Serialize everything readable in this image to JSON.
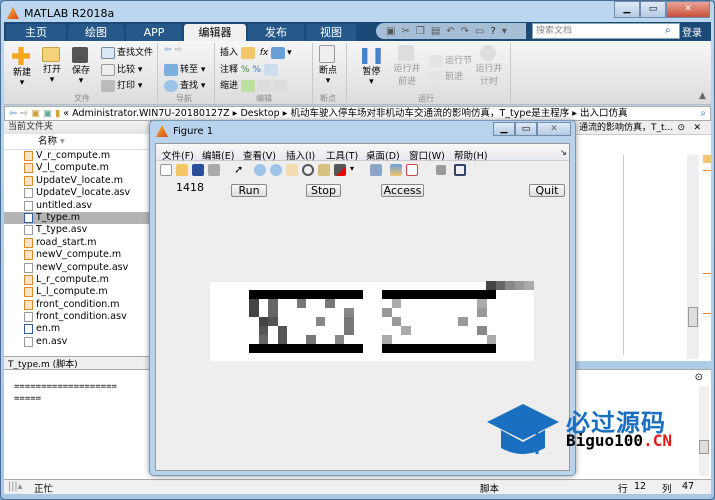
{
  "app": {
    "title": "MATLAB R2018a"
  },
  "tabs": [
    "主页",
    "绘图",
    "APP",
    "编辑器",
    "发布",
    "视图"
  ],
  "active_tab": "编辑器",
  "search": {
    "placeholder": "搜索文档"
  },
  "login": "登录",
  "ribbon": {
    "file": {
      "new": "新建",
      "open": "打开",
      "save": "保存",
      "find_files": "查找文件",
      "compare": "比较",
      "print": "打印",
      "group": "文件"
    },
    "nav": {
      "goto": "转至",
      "find": "查找",
      "group": "导航"
    },
    "edit": {
      "insert": "插入",
      "comment": "注释",
      "indent": "缩进",
      "fx": "fx",
      "group": "编辑"
    },
    "breakpoints": {
      "label": "断点",
      "group": "断点"
    },
    "run": {
      "pause": "暂停",
      "run_advance": "运行并前进",
      "run_section": "运行节",
      "advance": "前进",
      "run_time": "运行并计时",
      "group": "运行"
    }
  },
  "address": {
    "path": [
      "Administrator.WIN7U-20180127Z",
      "Desktop",
      "机动车驶入停车场对非机动车交通流的影响仿真，T_type是主程序",
      "出入口仿真"
    ]
  },
  "left_panel": {
    "title": "当前文件夹",
    "column": "名称",
    "files": [
      {
        "name": "V_r_compute.m",
        "type": "fx"
      },
      {
        "name": "V_l_compute.m",
        "type": "fx"
      },
      {
        "name": "UpdateV_locate.m",
        "type": "fx"
      },
      {
        "name": "UpdateV_locate.asv",
        "type": "txt"
      },
      {
        "name": "untitled.asv",
        "type": "txt"
      },
      {
        "name": "T_type.m",
        "type": "script",
        "selected": true
      },
      {
        "name": "T_type.asv",
        "type": "txt"
      },
      {
        "name": "road_start.m",
        "type": "fx"
      },
      {
        "name": "newV_compute.m",
        "type": "fx"
      },
      {
        "name": "newV_compute.asv",
        "type": "txt"
      },
      {
        "name": "L_r_compute.m",
        "type": "fx"
      },
      {
        "name": "L_l_compute.m",
        "type": "fx"
      },
      {
        "name": "front_condition.m",
        "type": "fx"
      },
      {
        "name": "front_condition.asv",
        "type": "txt"
      },
      {
        "name": "en.m",
        "type": "script"
      },
      {
        "name": "en.asv",
        "type": "txt"
      }
    ],
    "details": "T_type.m  (脚本)"
  },
  "editor_tab": "通流的影响仿真，T_t...",
  "command": {
    "lines": [
      "===================",
      "====="
    ]
  },
  "status": {
    "busy": "正忙",
    "mode": "脚本",
    "row_label": "行",
    "row": "12",
    "col_label": "列",
    "col": "47"
  },
  "figure": {
    "title": "Figure 1",
    "menu": [
      "文件(F)",
      "编辑(E)",
      "查看(V)",
      "插入(I)",
      "工具(T)",
      "桌面(D)",
      "窗口(W)",
      "帮助(H)"
    ],
    "counter": "1418",
    "buttons": {
      "run": "Run",
      "stop": "Stop",
      "access": "Access",
      "quit": "Quit"
    },
    "grid": {
      "bars": "black",
      "left_cells": [
        [
          1,
          0,
          "#444"
        ],
        [
          2,
          0,
          "#444"
        ],
        [
          1,
          2,
          "#666"
        ],
        [
          2,
          2,
          "#666"
        ],
        [
          3,
          1,
          "#444"
        ],
        [
          3,
          2,
          "#555"
        ],
        [
          4,
          1,
          "#555"
        ],
        [
          5,
          1,
          "#666"
        ],
        [
          4,
          3,
          "#555"
        ],
        [
          5,
          3,
          "#555"
        ],
        [
          1,
          5,
          "#777"
        ],
        [
          1,
          8,
          "#777"
        ],
        [
          3,
          7,
          "#888"
        ],
        [
          2,
          10,
          "#888"
        ],
        [
          3,
          10,
          "#777"
        ],
        [
          4,
          10,
          "#777"
        ],
        [
          5,
          6,
          "#777"
        ],
        [
          5,
          9,
          "#888"
        ]
      ],
      "right_cells": [
        [
          1,
          1,
          "#aaa"
        ],
        [
          2,
          0,
          "#999"
        ],
        [
          3,
          1,
          "#999"
        ],
        [
          4,
          2,
          "#aaa"
        ],
        [
          5,
          0,
          "#aaa"
        ],
        [
          3,
          8,
          "#999"
        ],
        [
          1,
          10,
          "#aaa"
        ],
        [
          2,
          10,
          "#999"
        ],
        [
          4,
          10,
          "#888"
        ],
        [
          5,
          11,
          "#aaa"
        ]
      ],
      "legend_shades": [
        "#444",
        "#666",
        "#888",
        "#999",
        "#aaa"
      ]
    }
  },
  "watermark": {
    "cn": "必过源码",
    "en": "Biguo100",
    "en_suffix": ".CN",
    "color": "#1a6fc0"
  }
}
